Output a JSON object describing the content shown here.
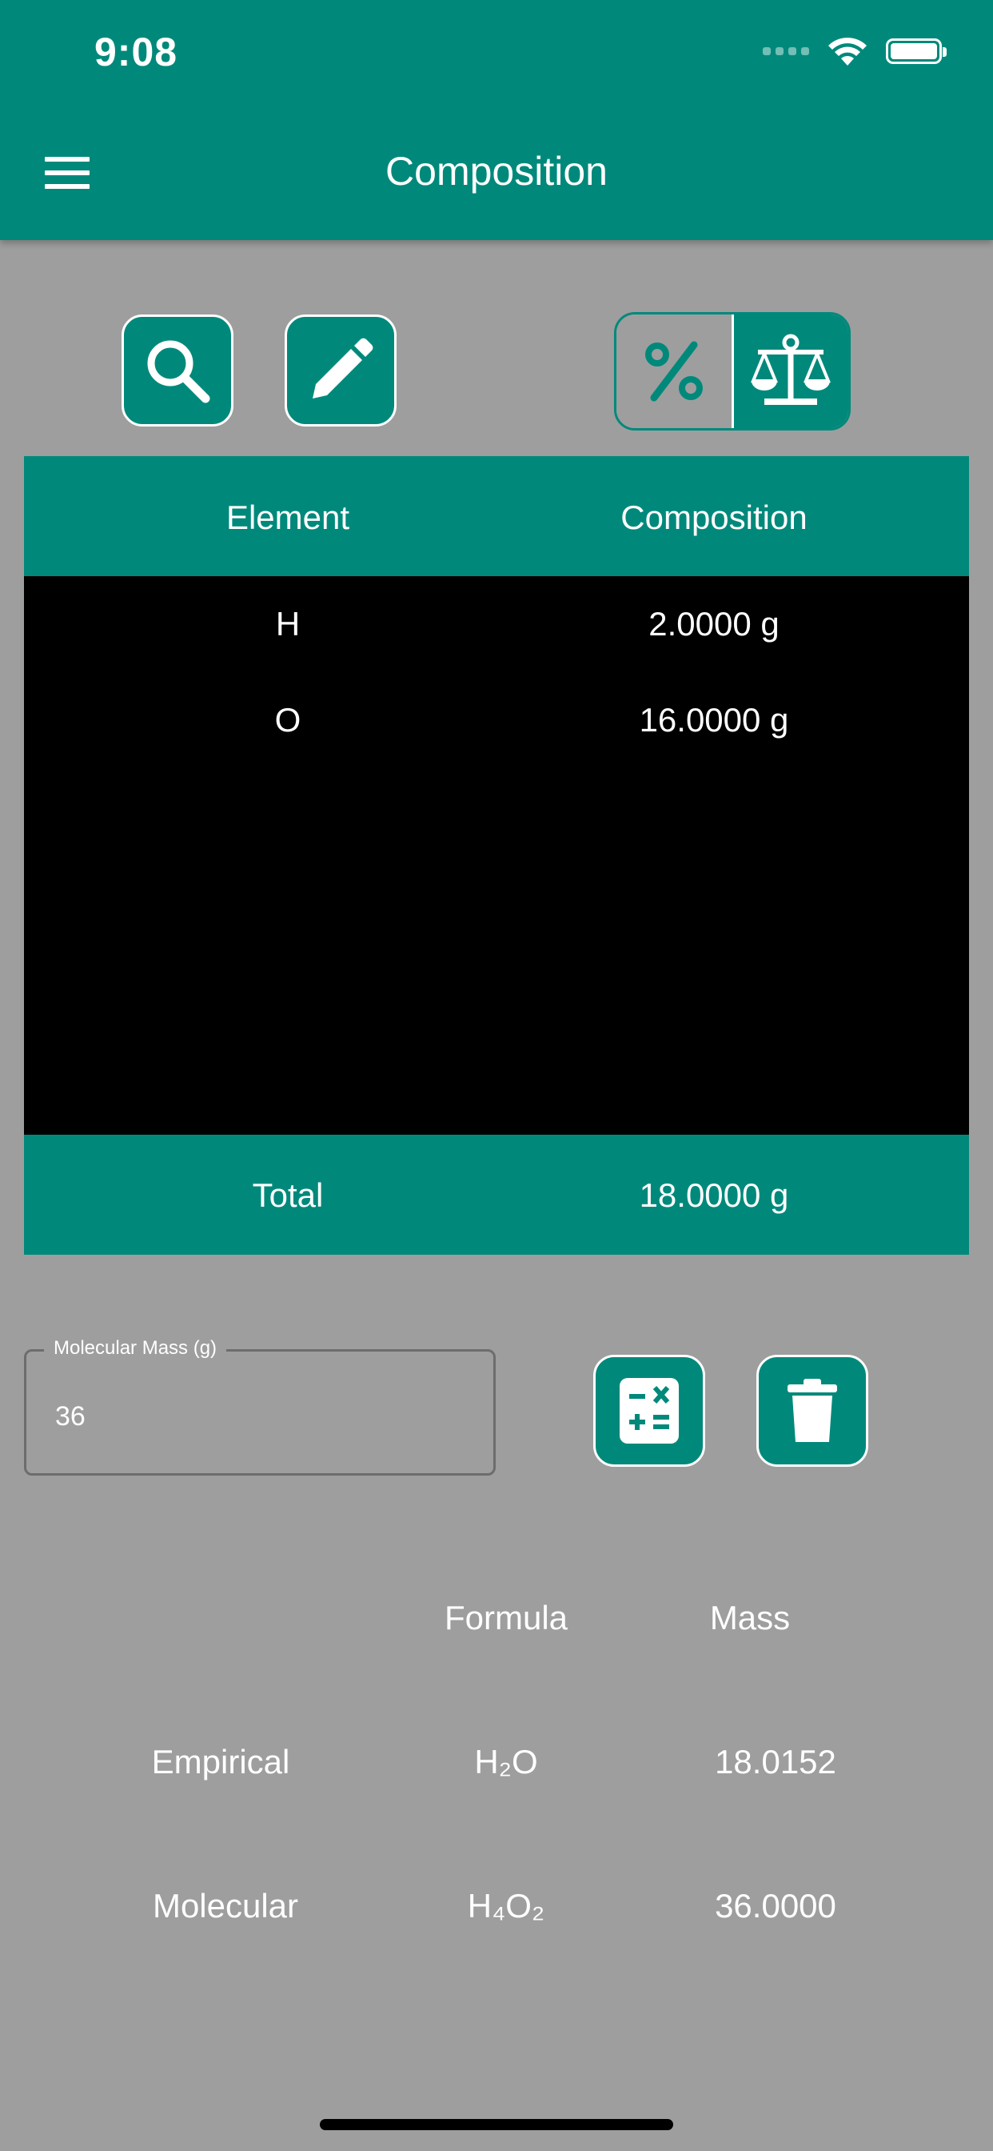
{
  "status_bar": {
    "time": "9:08"
  },
  "header": {
    "title": "Composition"
  },
  "toolbar": {
    "search_icon": "search-icon",
    "edit_icon": "pencil-icon",
    "toggle_options": [
      "percent",
      "mass"
    ],
    "toggle_selected": "mass"
  },
  "table": {
    "headers": [
      "Element",
      "Composition"
    ],
    "rows": [
      {
        "element": "H",
        "composition": "2.0000 g"
      },
      {
        "element": "O",
        "composition": "16.0000 g"
      }
    ],
    "footer": {
      "label": "Total",
      "value": "18.0000 g"
    }
  },
  "molecular_mass": {
    "label": "Molecular Mass (g)",
    "value": "36"
  },
  "results": {
    "headers": [
      "Formula",
      "Mass"
    ],
    "rows": [
      {
        "label": "Empirical",
        "formula": "H₂O",
        "mass": "18.0152"
      },
      {
        "label": "Molecular",
        "formula": "H₄O₂",
        "mass": "36.0000"
      }
    ]
  },
  "colors": {
    "primary": "#00897b",
    "background": "#9e9e9e",
    "table_body": "#000000"
  }
}
